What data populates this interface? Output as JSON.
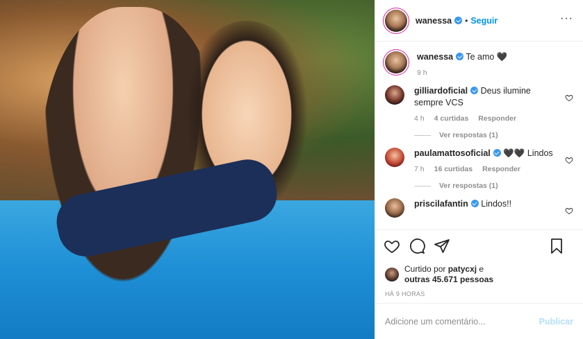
{
  "header": {
    "username": "wanessa",
    "follow_label": "Seguir",
    "separator": "•"
  },
  "caption": {
    "username": "wanessa",
    "text": "Te amo 🖤",
    "time": "9 h"
  },
  "comments": [
    {
      "username": "gilliardoficial",
      "text": "Deus ilumine sempre VCS",
      "time": "4 h",
      "likes": "4 curtidas",
      "reply_label": "Responder",
      "replies": "Ver respostas (1)"
    },
    {
      "username": "paulamattosoficial",
      "text": "🖤🖤 Lindos",
      "time": "7 h",
      "likes": "16 curtidas",
      "reply_label": "Responder",
      "replies": "Ver respostas (1)"
    },
    {
      "username": "priscilafantin",
      "text": "Lindos!!"
    }
  ],
  "likes": {
    "prefix": "Curtido por",
    "user": "patycxj",
    "suffix": "e",
    "others": "outras 45.671 pessoas"
  },
  "timestamp": "HÁ 9 HORAS",
  "add_comment": {
    "placeholder": "Adicione um comentário...",
    "post_label": "Publicar"
  },
  "icons": {
    "more": "more-options-icon",
    "like": "heart-icon",
    "comment": "comment-icon",
    "share": "share-icon",
    "save": "bookmark-icon",
    "verified": "verified-badge-icon"
  },
  "colors": {
    "accent": "#0095f6",
    "verified": "#3897f0",
    "muted": "#8e8e8e",
    "post_disabled": "#b2dffc"
  }
}
